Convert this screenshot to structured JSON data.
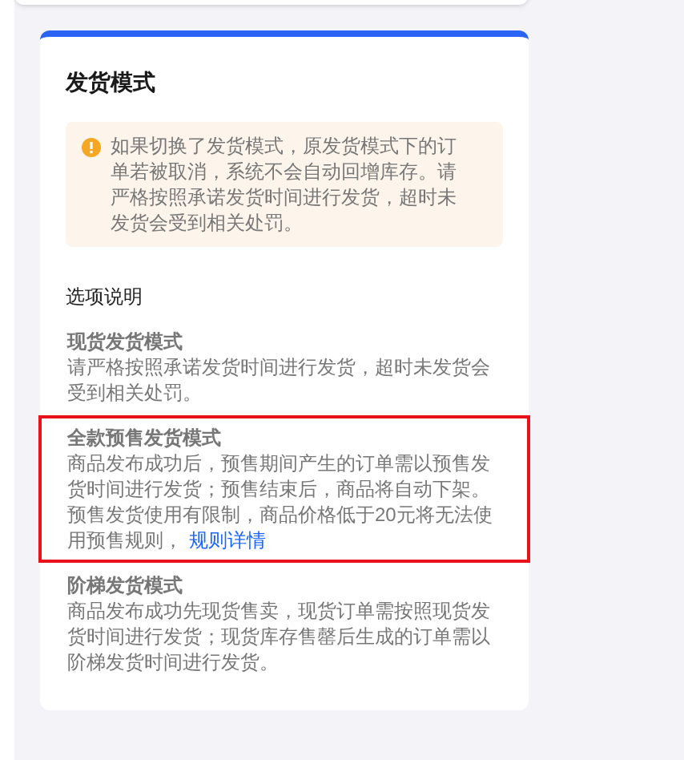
{
  "card": {
    "title": "发货模式",
    "alert": {
      "text": "如果切换了发货模式，原发货模式下的订单若被取消，系统不会自动回增库存。请严格按照承诺发货时间进行发货，超时未发货会受到相关处罚。"
    },
    "section_title": "选项说明",
    "options": [
      {
        "title": "现货发货模式",
        "description": "请严格按照承诺发货时间进行发货，超时未发货会受到相关处罚。",
        "highlighted": false
      },
      {
        "title": "全款预售发货模式",
        "description": "商品发布成功后，预售期间产生的订单需以预售发货时间进行发货；预售结束后，商品将自动下架。预售发货使用有限制，商品价格低于20元将无法使用预售规则，",
        "link": "规则详情",
        "highlighted": true
      },
      {
        "title": "阶梯发货模式",
        "description": "商品发布成功先现货售卖，现货订单需按照现货发货时间进行发货；现货库存售罄后生成的订单需以阶梯发货时间进行发货。",
        "highlighted": false
      }
    ]
  }
}
